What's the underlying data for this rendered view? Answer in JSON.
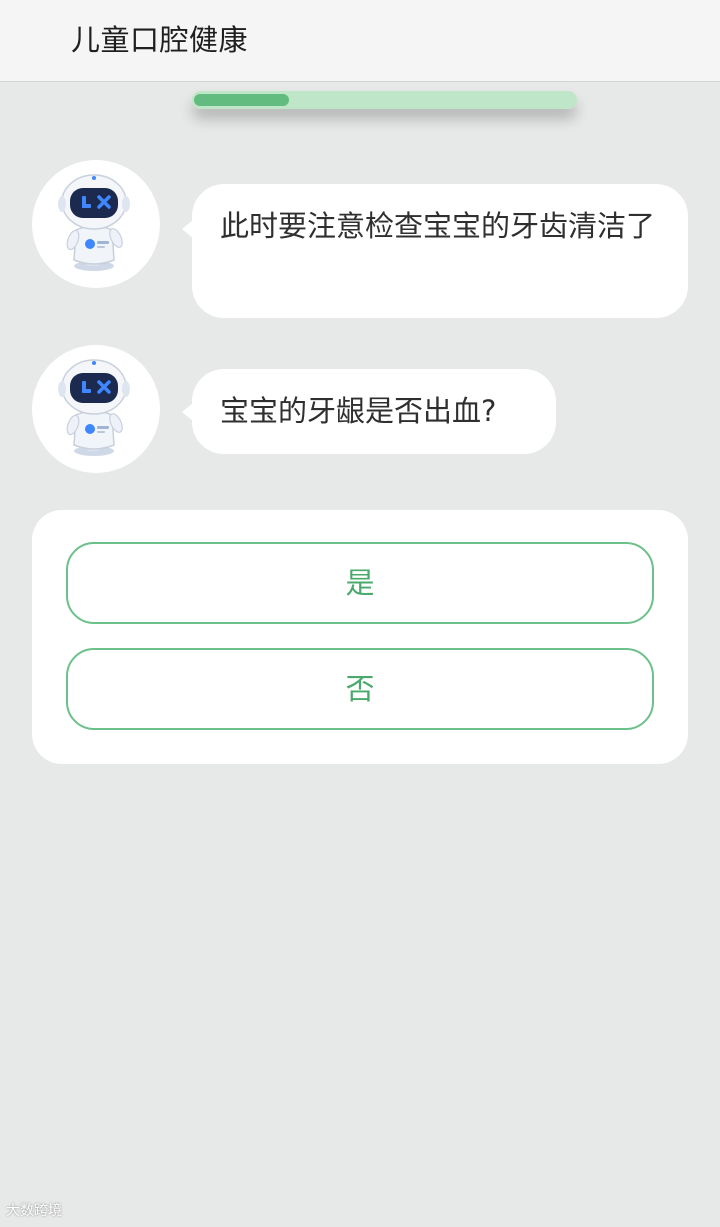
{
  "header": {
    "title": "儿童口腔健康"
  },
  "progress": {
    "fraction": 0.25
  },
  "chat": {
    "messages": [
      {
        "avatar_icon": "robot-mascot-icon",
        "text": "此时要注意检查宝宝的牙齿清洁了"
      },
      {
        "avatar_icon": "robot-mascot-icon",
        "text": "宝宝的牙龈是否出血?"
      }
    ]
  },
  "answers": {
    "yes_label": "是",
    "no_label": "否"
  },
  "watermark": {
    "text": "大数跨境"
  },
  "colors": {
    "accent_green": "#62bb7f",
    "progress_track": "#bfe6c8",
    "button_border": "#6cc08a",
    "button_text": "#4aa96c",
    "page_background": "#e7e8e8",
    "robot_screen": "#1b2a4e",
    "robot_eyes": "#3f86ff"
  }
}
